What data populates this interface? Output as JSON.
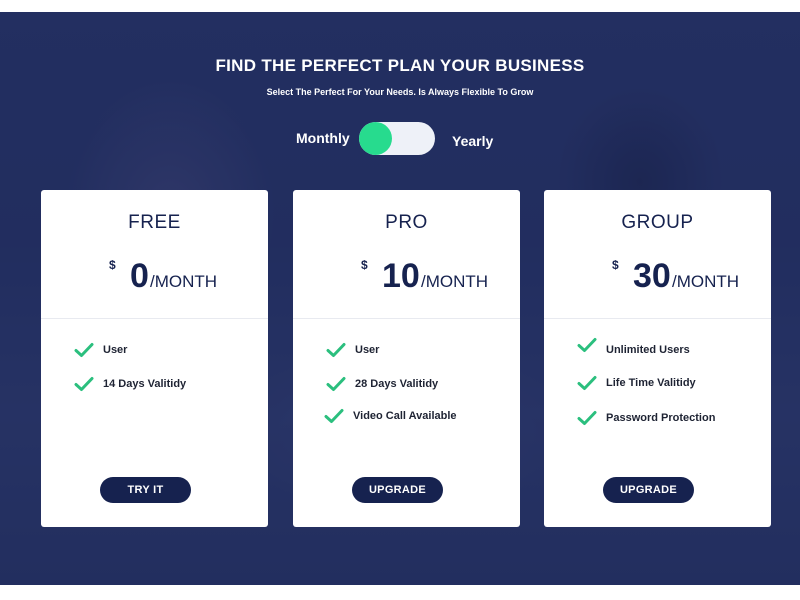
{
  "hero": {
    "title": "FIND THE PERFECT PLAN YOUR BUSINESS",
    "subtitle": "Select The Perfect For Your Needs. Is Always Flexible To Grow"
  },
  "billing_toggle": {
    "left_label": "Monthly",
    "right_label": "Yearly",
    "selected": "Monthly"
  },
  "plans": [
    {
      "name": "FREE",
      "currency": "$",
      "amount": "0",
      "period": "/MONTH",
      "features": [
        "User",
        "14 Days Valitidy"
      ],
      "button_label": "TRY IT"
    },
    {
      "name": "PRO",
      "currency": "$",
      "amount": "10",
      "period": "/MONTH",
      "features": [
        "User",
        "28 Days Valitidy",
        "Video Call Available"
      ],
      "button_label": "UPGRADE"
    },
    {
      "name": "GROUP",
      "currency": "$",
      "amount": "30",
      "period": "/MONTH",
      "features": [
        "Unlimited  Users",
        "Life Time Valitidy",
        "Password Protection"
      ],
      "button_label": "UPGRADE"
    }
  ],
  "icons": {
    "feature": "check-icon"
  },
  "colors": {
    "navy": "#16224f",
    "accent_green": "#27db8e",
    "check_green": "#2bbf7e",
    "overlay": "#1b275c"
  }
}
